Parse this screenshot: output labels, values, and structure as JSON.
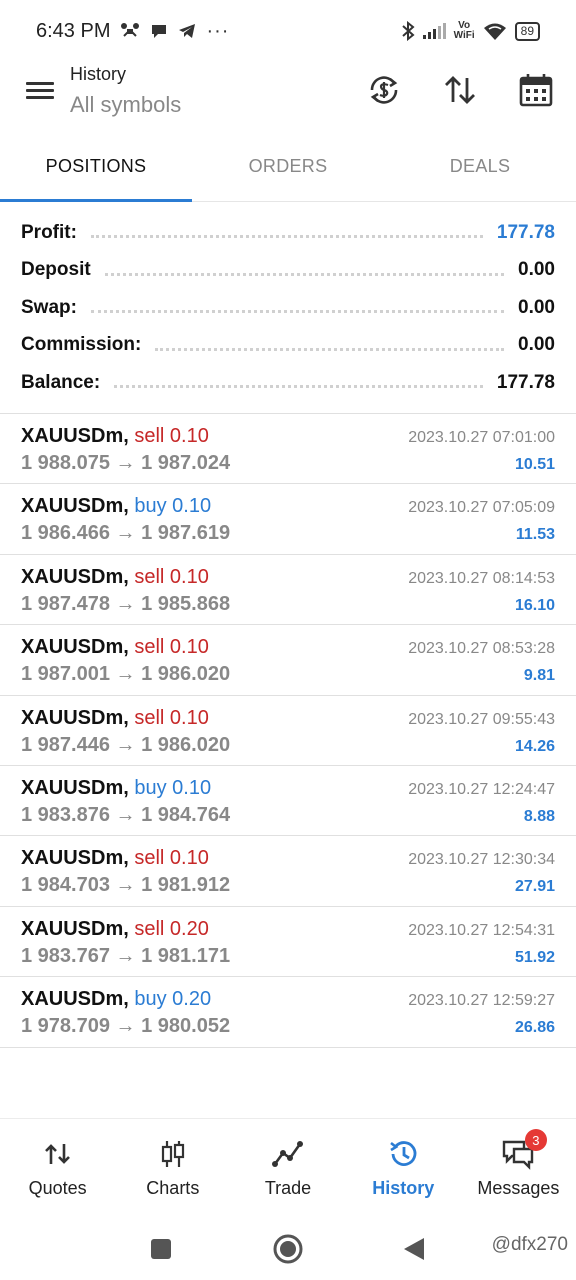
{
  "status_bar": {
    "time": "6:43 PM",
    "dots": "···",
    "vowifi_top": "Vo",
    "vowifi_bottom": "WiFi",
    "battery": "89"
  },
  "app_bar": {
    "subtitle": "History",
    "title": "All symbols",
    "icons": [
      "menu-icon",
      "currency-sync-icon",
      "sort-arrows-icon",
      "calendar-icon"
    ]
  },
  "tabs": [
    {
      "label": "POSITIONS",
      "active": true
    },
    {
      "label": "ORDERS",
      "active": false
    },
    {
      "label": "DEALS",
      "active": false
    }
  ],
  "summary": {
    "profit_label": "Profit:",
    "profit_value": "177.78",
    "deposit_label": "Deposit",
    "deposit_value": "0.00",
    "swap_label": "Swap:",
    "swap_value": "0.00",
    "commission_label": "Commission:",
    "commission_value": "0.00",
    "balance_label": "Balance:",
    "balance_value": "177.78"
  },
  "deals": [
    {
      "symbol": "XAUUSDm,",
      "type": "sell 0.10",
      "side": "sell",
      "open": "1 988.075",
      "close": "1 987.024",
      "time": "2023.10.27 07:01:00",
      "profit": "10.51"
    },
    {
      "symbol": "XAUUSDm,",
      "type": "buy 0.10",
      "side": "buy",
      "open": "1 986.466",
      "close": "1 987.619",
      "time": "2023.10.27 07:05:09",
      "profit": "11.53"
    },
    {
      "symbol": "XAUUSDm,",
      "type": "sell 0.10",
      "side": "sell",
      "open": "1 987.478",
      "close": "1 985.868",
      "time": "2023.10.27 08:14:53",
      "profit": "16.10"
    },
    {
      "symbol": "XAUUSDm,",
      "type": "sell 0.10",
      "side": "sell",
      "open": "1 987.001",
      "close": "1 986.020",
      "time": "2023.10.27 08:53:28",
      "profit": "9.81"
    },
    {
      "symbol": "XAUUSDm,",
      "type": "sell 0.10",
      "side": "sell",
      "open": "1 987.446",
      "close": "1 986.020",
      "time": "2023.10.27 09:55:43",
      "profit": "14.26"
    },
    {
      "symbol": "XAUUSDm,",
      "type": "buy 0.10",
      "side": "buy",
      "open": "1 983.876",
      "close": "1 984.764",
      "time": "2023.10.27 12:24:47",
      "profit": "8.88"
    },
    {
      "symbol": "XAUUSDm,",
      "type": "sell 0.10",
      "side": "sell",
      "open": "1 984.703",
      "close": "1 981.912",
      "time": "2023.10.27 12:30:34",
      "profit": "27.91"
    },
    {
      "symbol": "XAUUSDm,",
      "type": "sell 0.20",
      "side": "sell",
      "open": "1 983.767",
      "close": "1 981.171",
      "time": "2023.10.27 12:54:31",
      "profit": "51.92"
    },
    {
      "symbol": "XAUUSDm,",
      "type": "buy 0.20",
      "side": "buy",
      "open": "1 978.709",
      "close": "1 980.052",
      "time": "2023.10.27 12:59:27",
      "profit": "26.86"
    }
  ],
  "arrow": "→",
  "bottom_nav": [
    {
      "label": "Quotes",
      "icon": "quotes-arrows-icon",
      "active": false
    },
    {
      "label": "Charts",
      "icon": "candlestick-icon",
      "active": false
    },
    {
      "label": "Trade",
      "icon": "trade-line-icon",
      "active": false
    },
    {
      "label": "History",
      "icon": "history-clock-icon",
      "active": true
    },
    {
      "label": "Messages",
      "icon": "messages-icon",
      "active": false,
      "badge": "3"
    }
  ],
  "watermark": "@dfx270",
  "colors": {
    "accent": "#2b7cd3",
    "sell": "#c62828",
    "badge": "#e53935"
  }
}
